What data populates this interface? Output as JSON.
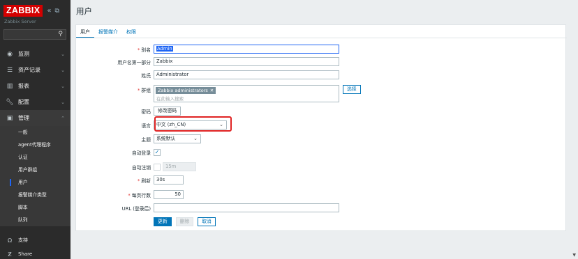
{
  "app": {
    "logo": "ZABBIX",
    "server_name": "Zabbix Server",
    "collapse_icon": "«",
    "kiosk_icon": "⧉"
  },
  "nav": {
    "items": [
      {
        "label": "监测",
        "icon": "eye-icon"
      },
      {
        "label": "资产记录",
        "icon": "list-icon"
      },
      {
        "label": "报表",
        "icon": "chart-icon"
      },
      {
        "label": "配置",
        "icon": "wrench-icon"
      },
      {
        "label": "管理",
        "icon": "gear-icon"
      }
    ],
    "sub_items": [
      "一般",
      "agent代理程序",
      "认证",
      "用户群组",
      "用户",
      "报警媒介类型",
      "脚本",
      "队列"
    ],
    "selected_sub": "用户",
    "bottom": [
      {
        "label": "支持",
        "icon": "support-icon"
      },
      {
        "label": "Share",
        "icon": "share-icon"
      }
    ]
  },
  "page": {
    "title": "用户",
    "tabs": [
      "用户",
      "报警媒介",
      "权限"
    ],
    "active_tab": "用户"
  },
  "form": {
    "alias_label": "别名",
    "alias_value": "Admin",
    "name_label": "用户名第一部分",
    "name_value": "Zabbix",
    "surname_label": "姓氏",
    "surname_value": "Administrator",
    "groups_label": "群组",
    "group_tag": "Zabbix administrators",
    "groups_placeholder": "在此输入搜索",
    "select_button": "选择",
    "password_label": "密码",
    "change_password_button": "修改密码",
    "language_label": "语言",
    "language_value": "中文 (zh_CN)",
    "theme_label": "主题",
    "theme_value": "系统默认",
    "autologin_label": "自动登录",
    "autologin_checked": true,
    "autologout_label": "自动注销",
    "autologout_value": "15m",
    "refresh_label": "刷新",
    "refresh_value": "30s",
    "rows_label": "每页行数",
    "rows_value": "50",
    "url_label": "URL (登录后)",
    "url_value": "",
    "update_button": "更新",
    "delete_button": "删除",
    "cancel_button": "取消"
  },
  "colors": {
    "sidebar_bg": "#2b2b2b",
    "logo_red": "#d40000",
    "accent_blue": "#0275b8",
    "highlight_red": "#e02323"
  }
}
